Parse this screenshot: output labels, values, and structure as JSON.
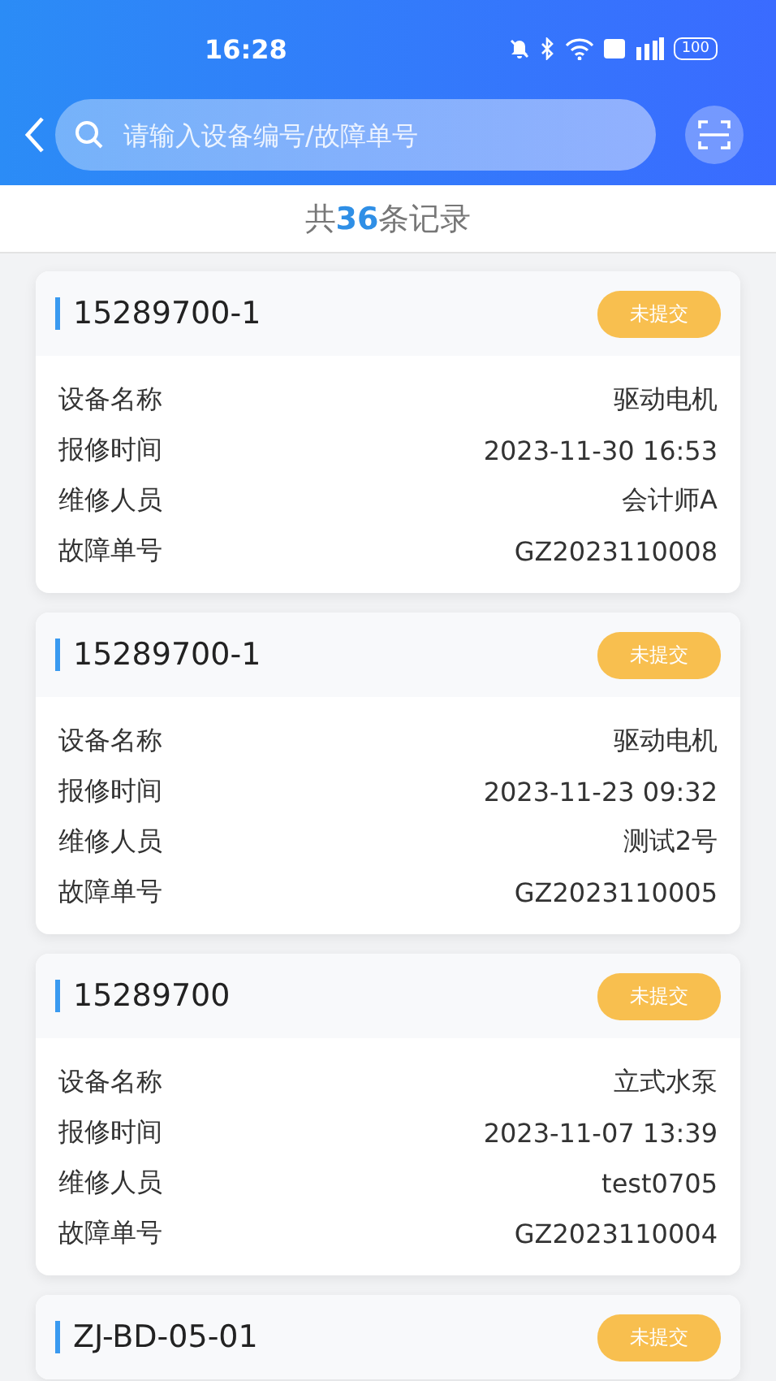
{
  "status_bar": {
    "time": "16:28",
    "battery": "100"
  },
  "search": {
    "placeholder": "请输入设备编号/故障单号"
  },
  "summary": "共**36**条记录",
  "records": [
    {
      "code": "15289700-1",
      "status": "未提交",
      "fields": [
        {
          "label": "设备名称",
          "value": "驱动电机"
        },
        {
          "label": "报修时间",
          "value": "2023-11-30 16:53"
        },
        {
          "label": "维修人员",
          "value": "会计师A"
        },
        {
          "label": "故障单号",
          "value": "GZ2023110008"
        }
      ]
    },
    {
      "code": "15289700-1",
      "status": "未提交",
      "fields": [
        {
          "label": "设备名称",
          "value": "驱动电机"
        },
        {
          "label": "报修时间",
          "value": "2023-11-23 09:32"
        },
        {
          "label": "维修人员",
          "value": "测试2号"
        },
        {
          "label": "故障单号",
          "value": "GZ2023110005"
        }
      ]
    },
    {
      "code": "15289700",
      "status": "未提交",
      "fields": [
        {
          "label": "设备名称",
          "value": "立式水泵"
        },
        {
          "label": "报修时间",
          "value": "2023-11-07 13:39"
        },
        {
          "label": "维修人员",
          "value": "test0705"
        },
        {
          "label": "故障单号",
          "value": "GZ2023110004"
        }
      ]
    },
    {
      "code": "ZJ-BD-05-01",
      "status": "未提交"
    }
  ]
}
